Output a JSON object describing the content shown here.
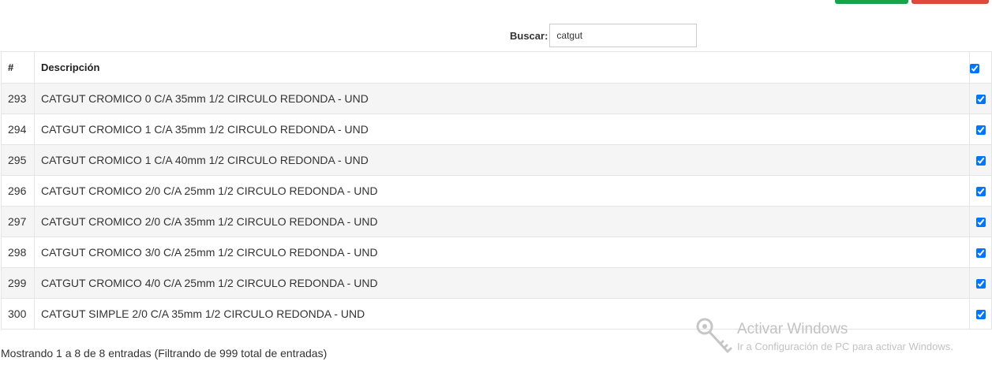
{
  "toolbar": {
    "accent_green": "#16a34a",
    "accent_red": "#dc4a3c"
  },
  "search": {
    "label": "Buscar:",
    "value": "catgut"
  },
  "table": {
    "headers": {
      "num": "#",
      "description": "Descripción"
    },
    "header_checked": true,
    "rows": [
      {
        "id": "293",
        "description": "CATGUT CROMICO 0 C/A 35mm 1/2 CIRCULO REDONDA - UND",
        "checked": true
      },
      {
        "id": "294",
        "description": "CATGUT CROMICO 1 C/A 35mm 1/2 CIRCULO REDONDA - UND",
        "checked": true
      },
      {
        "id": "295",
        "description": "CATGUT CROMICO 1 C/A 40mm 1/2 CIRCULO REDONDA - UND",
        "checked": true
      },
      {
        "id": "296",
        "description": "CATGUT CROMICO 2/0 C/A 25mm 1/2 CIRCULO REDONDA - UND",
        "checked": true
      },
      {
        "id": "297",
        "description": "CATGUT CROMICO 2/0 C/A 35mm 1/2 CIRCULO REDONDA - UND",
        "checked": true
      },
      {
        "id": "298",
        "description": "CATGUT CROMICO 3/0 C/A 25mm 1/2 CIRCULO REDONDA - UND",
        "checked": true
      },
      {
        "id": "299",
        "description": "CATGUT CROMICO 4/0 C/A 25mm 1/2 CIRCULO REDONDA - UND",
        "checked": true
      },
      {
        "id": "300",
        "description": "CATGUT SIMPLE 2/0 C/A 35mm 1/2 CIRCULO REDONDA - UND",
        "checked": true
      }
    ]
  },
  "footer": {
    "info": "Mostrando 1 a 8 de 8 entradas (Filtrando de 999 total de entradas)"
  },
  "watermark": {
    "title": "Activar Windows",
    "subtitle": "Ir a Configuración de PC para activar Windows.",
    "icon": "key-icon"
  }
}
